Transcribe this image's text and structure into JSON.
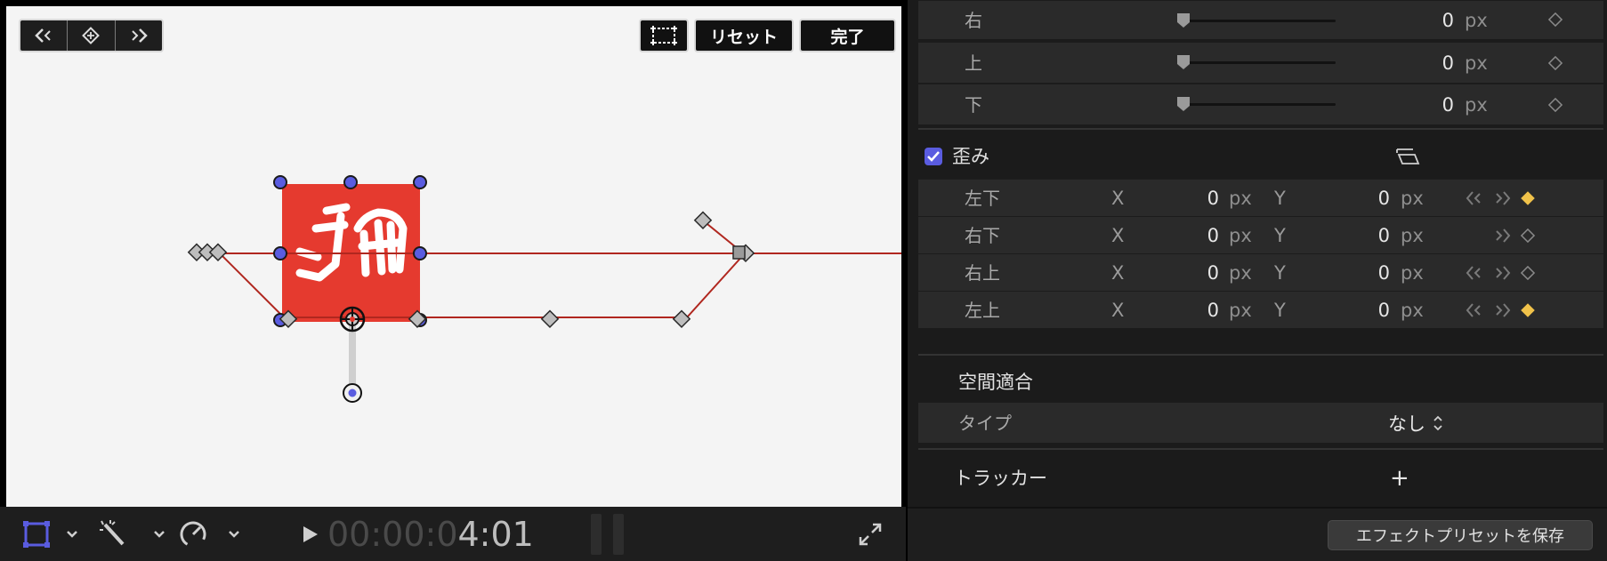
{
  "viewer": {
    "toolbar_top": {
      "reset_label": "リセット",
      "done_label": "完了"
    },
    "timecode": {
      "dim": "00:00:0",
      "lit": "4:01"
    }
  },
  "inspector": {
    "trim_rows": [
      {
        "label": "右",
        "value": "0",
        "unit": "px"
      },
      {
        "label": "上",
        "value": "0",
        "unit": "px"
      },
      {
        "label": "下",
        "value": "0",
        "unit": "px"
      }
    ],
    "distort": {
      "title": "歪み",
      "checked": true,
      "x_axis": "X",
      "y_axis": "Y",
      "rows": [
        {
          "label": "左下",
          "x": "0",
          "y": "0",
          "unit": "px",
          "keyframe": "active"
        },
        {
          "label": "右下",
          "x": "0",
          "y": "0",
          "unit": "px",
          "keyframe": "empty"
        },
        {
          "label": "右上",
          "x": "0",
          "y": "0",
          "unit": "px",
          "keyframe": "empty"
        },
        {
          "label": "左上",
          "x": "0",
          "y": "0",
          "unit": "px",
          "keyframe": "active"
        }
      ]
    },
    "spatial": {
      "title": "空間適合",
      "type_label": "タイプ",
      "type_value": "なし"
    },
    "tracker": {
      "label": "トラッカー",
      "add": "+"
    },
    "save_preset_label": "エフェクトプリセットを保存"
  },
  "colors": {
    "accent": "#5a5ce0",
    "keyframe_active": "#f0c24a",
    "image_red": "#e53a2f",
    "path_red": "#b0271f"
  }
}
